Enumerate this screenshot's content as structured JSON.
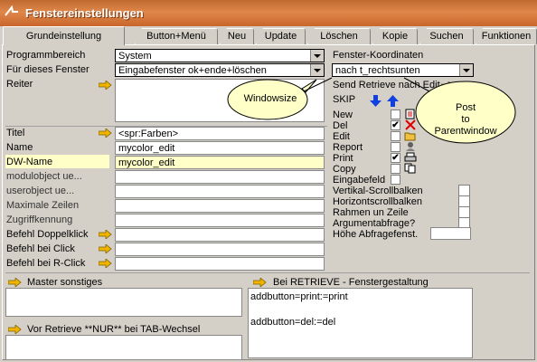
{
  "window": {
    "title": "Fenstereinstellungen"
  },
  "tabs": [
    "Grundeinstellung",
    "Button+Menü",
    "Neu",
    "Update",
    "Löschen",
    "Kopie",
    "Suchen",
    "Funktionen"
  ],
  "fields": {
    "programmbereich": {
      "label": "Programmbereich",
      "value": "System"
    },
    "fuer_dieses_fenster": {
      "label": "Für dieses Fenster",
      "value": "Eingabefenster ok+ende+löschen"
    },
    "reiter": {
      "label": "Reiter"
    },
    "titel": {
      "label": "Titel",
      "value": "<spr:Farben>"
    },
    "name": {
      "label": "Name",
      "value": "mycolor_edit"
    },
    "dw_name": {
      "label": "DW-Name",
      "value": "mycolor_edit"
    },
    "modulobject": {
      "label": "modulobject ue..."
    },
    "userobject": {
      "label": "userobject ue..."
    },
    "maximale_zeilen": {
      "label": "Maximale Zeilen"
    },
    "zugriffkennung": {
      "label": "Zugriffkennung"
    },
    "befehl_doppelklick": {
      "label": "Befehl Doppelklick"
    },
    "befehl_click": {
      "label": "Befehl bei Click"
    },
    "befehl_rclick": {
      "label": "Befehl bei R-Click"
    }
  },
  "right": {
    "fenster_koordinaten": {
      "label": "Fenster-Koordinaten",
      "value": "nach t_rechtsunten"
    },
    "send_retrieve": "Send Retrieve nach Edit",
    "skip": "SKIP",
    "options": [
      {
        "label": "New",
        "checked": false
      },
      {
        "label": "Del",
        "checked": true
      },
      {
        "label": "Edit",
        "checked": false
      },
      {
        "label": "Report",
        "checked": false
      },
      {
        "label": "Print",
        "checked": true
      },
      {
        "label": "Copy",
        "checked": false
      },
      {
        "label": "Eingabefeld",
        "checked": false
      }
    ],
    "extras": [
      {
        "label": "Vertikal-Scrollbalken"
      },
      {
        "label": "Horizontscrollbalken"
      },
      {
        "label": "Rahmen un Zeile"
      },
      {
        "label": "Argumentabfrage?"
      }
    ],
    "hoehe": {
      "label": "Höhe Abfragefenst."
    }
  },
  "bottom": {
    "master_sonstiges": "Master sonstiges",
    "vor_retrieve": "Vor Retrieve **NUR** bei TAB-Wechsel",
    "bei_retrieve": "Bei RETRIEVE - Fenstergestaltung",
    "retrieve_text": "addbutton=print:=print\n\naddbutton=del:=del"
  },
  "callouts": {
    "windowsize": "Windowsize",
    "post": "Post\nto\nParentwindow"
  },
  "colors": {
    "title_bar": "#d97b3e",
    "yellow_field": "#ffffc8",
    "arrow": "#f0b400"
  }
}
